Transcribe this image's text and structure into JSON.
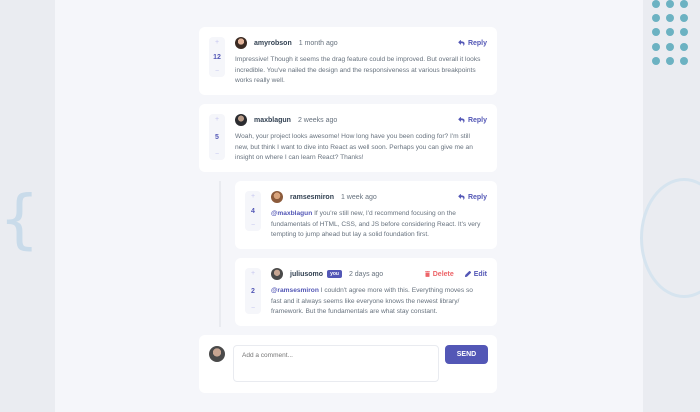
{
  "colors": {
    "accent": "#5357b6",
    "delete": "#ed6468",
    "page_bg": "#f5f6fa",
    "card_bg": "#ffffff",
    "dots": "#6cb2c2"
  },
  "comments": [
    {
      "username": "amyrobson",
      "time": "1 month ago",
      "score": "12",
      "reply_label": "Reply",
      "text": "Impressive! Though it seems the drag feature could be improved. But overall it looks incredible. You've nailed the design and the responsiveness at various breakpoints works really well."
    },
    {
      "username": "maxblagun",
      "time": "2 weeks ago",
      "score": "5",
      "reply_label": "Reply",
      "text": "Woah, your project looks awesome! How long have you been coding for? I'm still new, but think I want to dive into React as well soon. Perhaps you can give me an insight on where I can learn React? Thanks!"
    }
  ],
  "replies": [
    {
      "username": "ramsesmiron",
      "time": "1 week ago",
      "score": "4",
      "reply_label": "Reply",
      "mention": "@maxblagun",
      "text": " If you're still new, I'd recommend focusing on the fundamentals of HTML, CSS, and JS before considering React. It's very tempting to jump ahead but lay a solid foundation first."
    },
    {
      "username": "juliusomo",
      "you_badge": "you",
      "time": "2 days ago",
      "score": "2",
      "delete_label": "Delete",
      "edit_label": "Edit",
      "mention": "@ramsesmiron",
      "text": " I couldn't agree more with this. Everything moves so fast and it always seems like everyone knows the newest library/ framework. But the fundamentals are what stay constant."
    }
  ],
  "vote": {
    "plus": "+",
    "minus": "−"
  },
  "composer": {
    "placeholder": "Add a comment...",
    "send_label": "SEND"
  },
  "icons": {
    "reply": "reply-icon",
    "delete": "trash-icon",
    "edit": "pencil-icon"
  }
}
